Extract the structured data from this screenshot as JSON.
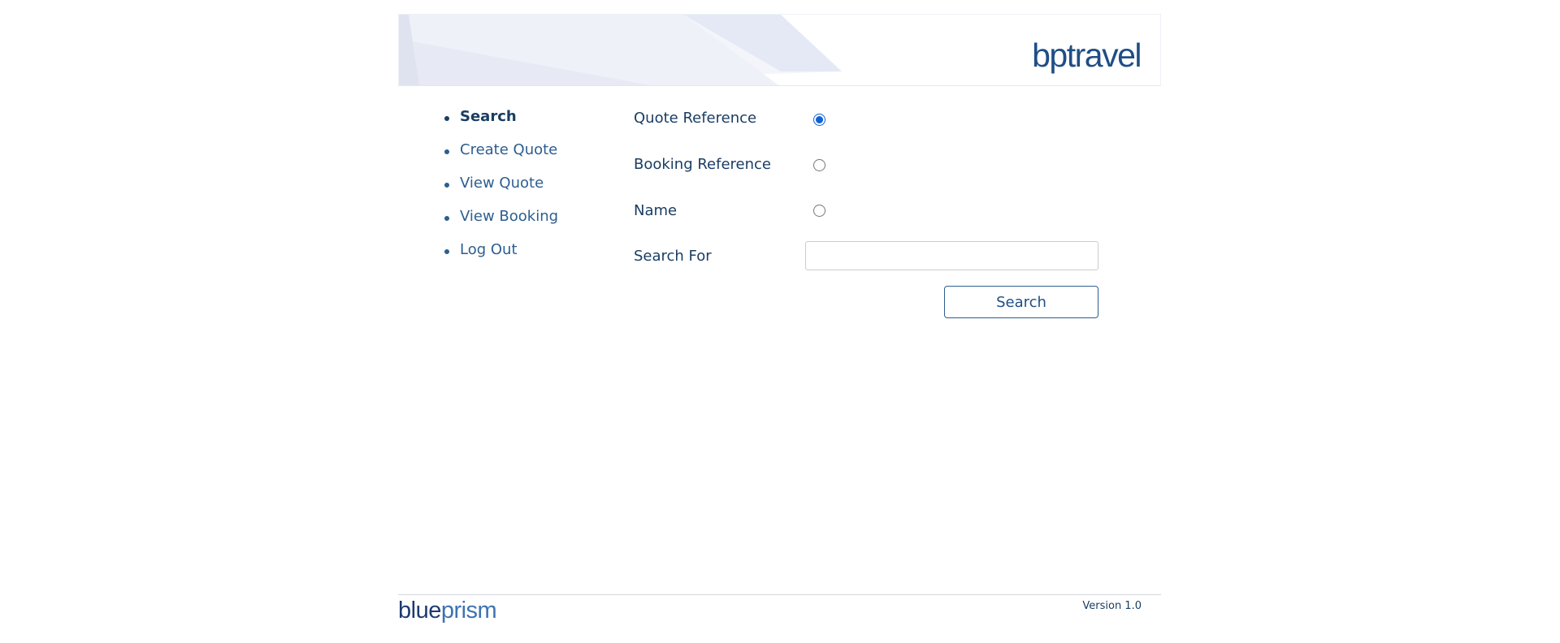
{
  "header": {
    "logo_text": "bptravel",
    "banner_color": "#e8ecf6"
  },
  "nav": {
    "items": [
      {
        "label": "Search",
        "active": true
      },
      {
        "label": "Create Quote",
        "active": false
      },
      {
        "label": "View Quote",
        "active": false
      },
      {
        "label": "View Booking",
        "active": false
      },
      {
        "label": "Log Out",
        "active": false
      }
    ]
  },
  "search_form": {
    "options": [
      {
        "label": "Quote Reference",
        "selected": true
      },
      {
        "label": "Booking Reference",
        "selected": false
      },
      {
        "label": "Name",
        "selected": false
      }
    ],
    "search_for_label": "Search For",
    "search_for_value": "",
    "search_button_label": "Search"
  },
  "footer": {
    "logo_blue": "blue",
    "logo_prism": "prism",
    "version": "Version 1.0"
  },
  "colors": {
    "accent": "#1f4e86",
    "link": "#2c5e90",
    "radio_selected": "#0f62d6"
  }
}
